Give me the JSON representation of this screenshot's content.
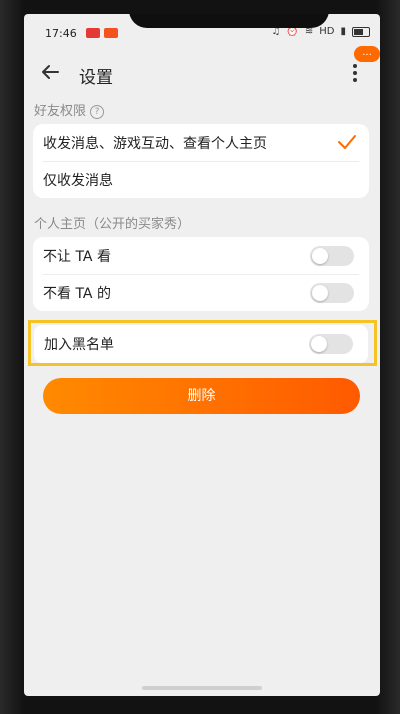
{
  "status_bar": {
    "time": "17:46",
    "network": "HD"
  },
  "header": {
    "title": "设置",
    "back_icon": "back-arrow-icon",
    "more_icon": "more-vertical-icon",
    "badge": "..."
  },
  "friend_permissions": {
    "section_label": "好友权限",
    "options": [
      {
        "label": "收发消息、游戏互动、查看个人主页",
        "selected": true
      },
      {
        "label": "仅收发消息",
        "selected": false
      }
    ]
  },
  "homepage": {
    "section_label": "个人主页（公开的买家秀）",
    "items": [
      {
        "label": "不让 TA 看",
        "enabled": false
      },
      {
        "label": "不看 TA 的",
        "enabled": false
      }
    ]
  },
  "blacklist": {
    "label": "加入黑名单",
    "enabled": false
  },
  "delete_button": {
    "label": "删除"
  },
  "colors": {
    "accent": "#ff6a00",
    "highlight": "#f6c324",
    "background": "#efefef"
  }
}
